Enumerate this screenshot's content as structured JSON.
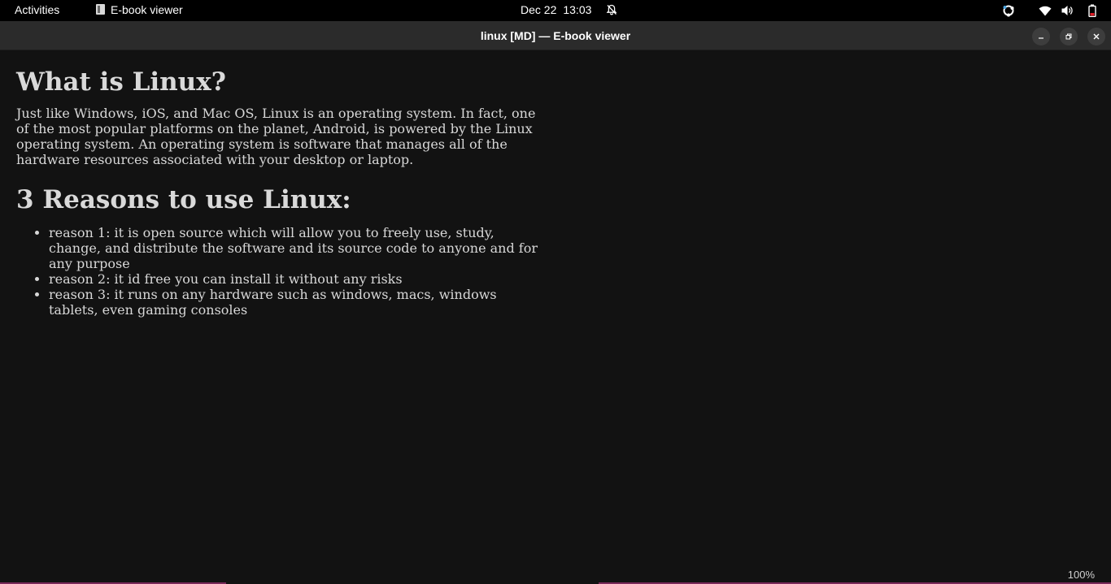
{
  "topbar": {
    "activities_label": "Activities",
    "app_name": "E-book viewer",
    "date": "Dec 22",
    "time": "13:03"
  },
  "window": {
    "title": "linux [MD] — E-book viewer"
  },
  "document": {
    "heading1": "What is Linux?",
    "paragraph": "Just like Windows, iOS, and Mac OS, Linux is an operating system. In fact, one of the most popular platforms on the planet, Android, is powered by the Linux operating system. An operating system is software that manages all of the hardware resources associated with your desktop or laptop.",
    "heading2": "3 Reasons to use Linux:",
    "reasons": [
      "reason 1: it is open source which will allow you to freely use, study, change, and distribute the software and its source code to anyone and for any purpose",
      "reason 2: it id free you can install it without any risks",
      "reason 3: it runs on any hardware such as windows, macs, windows tablets, even gaming consoles"
    ]
  },
  "status": {
    "zoom": "100%"
  },
  "icons": {
    "app": "ebook-viewer-icon",
    "notifications": "bell-muted-icon",
    "extension": "ubuntu-extension-icon",
    "network": "wifi-icon",
    "volume": "volume-icon",
    "battery": "battery-icon",
    "minimize": "minimize-icon",
    "maximize": "restore-icon",
    "close": "close-icon"
  },
  "colors": {
    "background": "#121212",
    "text": "#d8d8d8",
    "topbar": "#000000",
    "titlebar": "#2b2b2b",
    "battery_accent": "#e01b24"
  }
}
